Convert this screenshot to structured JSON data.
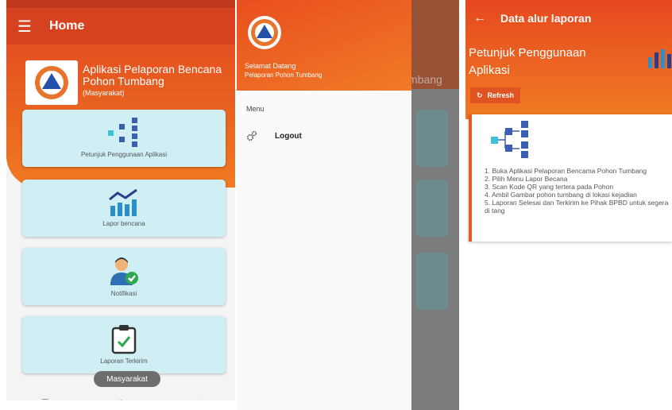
{
  "home": {
    "title": "Home",
    "app_name": "Aplikasi Pelaporan Bencana Pohon Tumbang",
    "role": "(Masyarakat)",
    "menu": [
      {
        "label": "Petunjuk Penggunaan Aplikasi",
        "icon": "hierarchy-icon"
      },
      {
        "label": "Lapor bencana",
        "icon": "chart-icon"
      },
      {
        "label": "Notifikasi",
        "icon": "user-check-icon"
      },
      {
        "label": "Laporan Terkirim",
        "icon": "clipboard-check-icon"
      }
    ],
    "toast": "Masyarakat"
  },
  "drawer": {
    "welcome": "Selamat Datang",
    "subtitle": "Pelaporan Pohon Tumbang",
    "section": "Menu",
    "items": [
      {
        "label": "Logout",
        "icon": "gears-icon"
      }
    ],
    "behind_text": "mbang"
  },
  "report_flow": {
    "title": "Data alur laporan",
    "guide_title": "Petunjuk Penggunaan Aplikasi",
    "refresh_label": "Refresh",
    "steps": [
      "1. Buka Aplikasi Pelaporan Bencama Pohon Tumbang",
      "2. Pilih Menu Lapor Becana",
      "3. Scan Kode QR yang tertera pada Pohon",
      "4. Ambil Gambar pohon tumbang di lokasi kejadian",
      "5. Laporan Selesai dan Terkirim ke Pihak BPBD untuk segera di tang"
    ]
  },
  "colors": {
    "primary": "#d6421f",
    "accent": "#f07a23",
    "card": "#cfeff5",
    "icon_blue": "#3a5fb0"
  }
}
